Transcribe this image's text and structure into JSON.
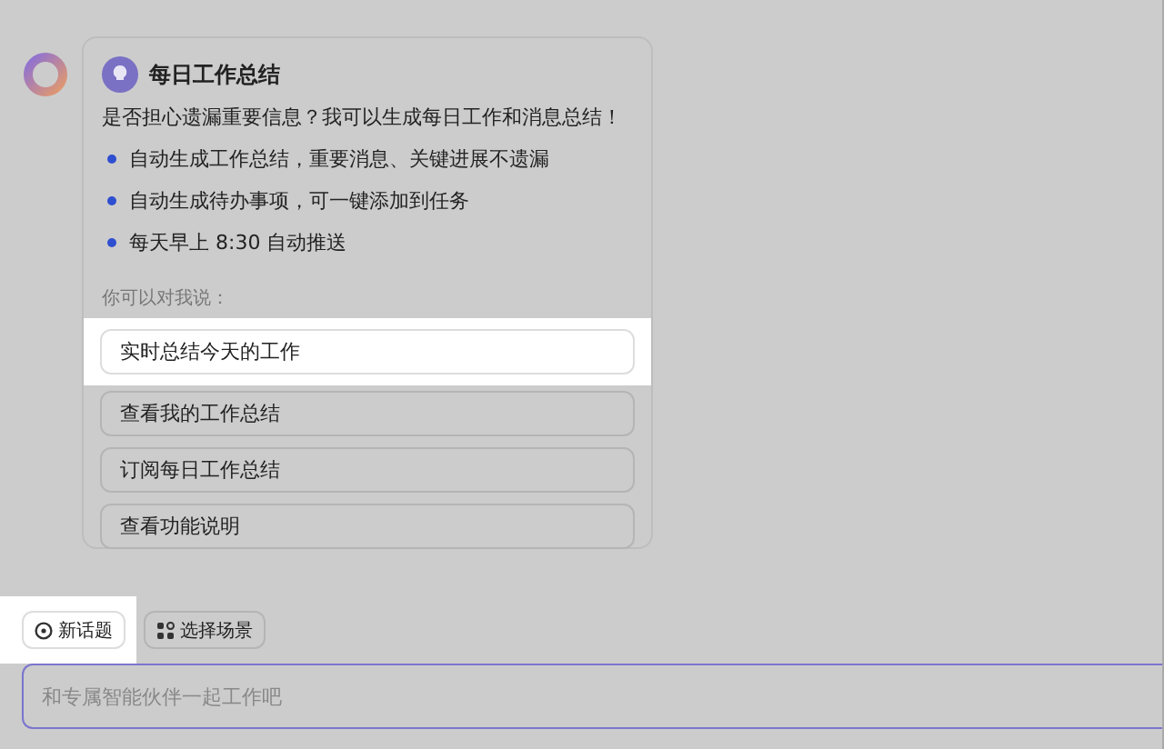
{
  "card": {
    "title": "每日工作总结",
    "intro": "是否担心遗漏重要信息？我可以生成每日工作和消息总结！",
    "features": [
      "自动生成工作总结，重要消息、关键进展不遗漏",
      "自动生成待办事项，可一键添加到任务",
      "每天早上 8:30 自动推送"
    ],
    "prompt_label": "你可以对我说：",
    "suggestions": [
      {
        "label": "实时总结今天的工作",
        "highlighted": true
      },
      {
        "label": "查看我的工作总结",
        "highlighted": false
      },
      {
        "label": "订阅每日工作总结",
        "highlighted": false
      },
      {
        "label": "查看功能说明",
        "highlighted": false
      }
    ]
  },
  "toolbar": [
    {
      "label": "新话题",
      "kind": "new",
      "highlighted": true
    },
    {
      "label": "选择场景",
      "kind": "scene",
      "highlighted": false
    }
  ],
  "input": {
    "placeholder": "和专属智能伙伴一起工作吧"
  }
}
